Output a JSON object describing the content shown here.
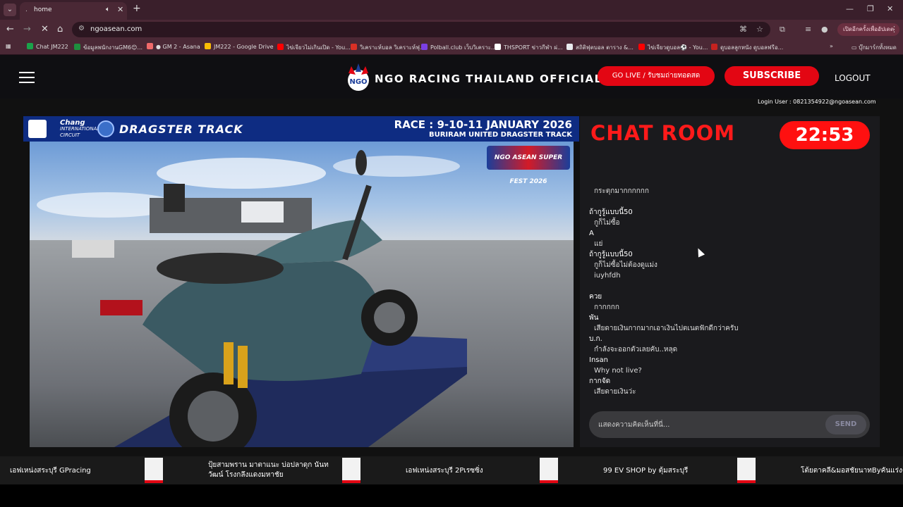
{
  "browser": {
    "tab": {
      "title": "home",
      "favicon": "."
    },
    "address": {
      "url": "ngoasean.com"
    },
    "profile_button": "เปิดอีกครั้งเพื่ออัปเดต",
    "bookmarks": [
      {
        "label": "Chat JM222",
        "color": "#1aa34a"
      },
      {
        "label": "ข้อมูลพนักงานGM6😊...",
        "color": "#1e8e3e"
      },
      {
        "label": "● GM 2 - Asana",
        "color": "#f06a6a"
      },
      {
        "label": "JM222 - Google Drive",
        "color": "#fbbc04"
      },
      {
        "label": "ไข่เจียวไม่เกินเปิด - You...",
        "color": "#ff0000"
      },
      {
        "label": "วิเคราะห์บอล วิเคราะห์ฟุ...",
        "color": "#d93025"
      },
      {
        "label": "Polball.club เว็บวิเคราะ...",
        "color": "#7b3fe4"
      },
      {
        "label": "THSPORT ข่าวกีฬา ผ่...",
        "color": "#ffffff"
      },
      {
        "label": "สถิติฟุตบอล ตาราง &...",
        "color": "#e8eaed"
      },
      {
        "label": "ไข่เจียวดูบอล⚽ - You...",
        "color": "#ff0000"
      },
      {
        "label": "ดูบอลลูกหนัง ดูบอลฟรีอ...",
        "color": "#c5221f"
      }
    ],
    "other_bookmarks": "บุ๊กมาร์กทั้งหมด"
  },
  "header": {
    "site_title": "NGO RACING THAILAND OFFICIAL",
    "live_button": "GO LIVE / รับชมถ่ายทอดสด",
    "subscribe_button": "SUBSCRIBE",
    "logout_button": "LOGOUT",
    "login_user": "Login User : 0821354922@ngoasean.com"
  },
  "video": {
    "chang_line1": "Chang",
    "chang_line2": "INTERNATIONAL",
    "chang_line3": "CIRCUIT",
    "dragster": "DRAGSTER TRACK",
    "race_title": "RACE : 9-10-11 JANUARY 2026",
    "race_subtitle": "BURIRAM UNITED DRAGSTER TRACK",
    "watermark": "NGO ASEAN SUPER FEST 2026"
  },
  "chat": {
    "title": "CHAT ROOM",
    "timer": "22:53",
    "messages": [
      {
        "name": "",
        "text": "กระตุกมากกกกกก"
      },
      {
        "name": "",
        "text": ""
      },
      {
        "name": "ถ้ากูรู้แบบนี้50",
        "text": "กูก็ไม่ซื้อ"
      },
      {
        "name": "A",
        "text": "แย่"
      },
      {
        "name": "ถ้ากูรู้แบบนี้50",
        "text": "กูก็ไม่ซื้อไม่ต้องดูแม่ง"
      },
      {
        "name": "",
        "text": "iuyhfdh"
      },
      {
        "name": "",
        "text": ""
      },
      {
        "name": "ควย",
        "text": "กากกกก"
      },
      {
        "name": "พัน",
        "text": "เสียดายเงินกากมากเอาเงินไปตเนตฟักดีกว่าครับ"
      },
      {
        "name": "บ.ก.",
        "text": "กำลังจะออกตัวเลยคับ..หลุด"
      },
      {
        "name": "Insan",
        "text": "Why not live?"
      },
      {
        "name": "กากจัด",
        "text": "เสียดายเงินว่ะ"
      }
    ],
    "input_placeholder": "แสดงความคิดเห็นที่นี่...",
    "send_button": "SEND"
  },
  "ticker": [
    "เอฟเหน่งสระบุรี GPracing",
    "ปุ้ยสามพราน มาตาแนะ บ่อปลาดุก นันทวัฒน์ โรงกลึงแดงมหาชัย",
    "เอฟเหน่งสระบุรี 2Pเรซซิ่ง",
    "99 EV SHOP by ตุ้มสระบุรี",
    "โต้ยตาคลี&มอสชัยนาทByคันแร่งค้ำ"
  ]
}
